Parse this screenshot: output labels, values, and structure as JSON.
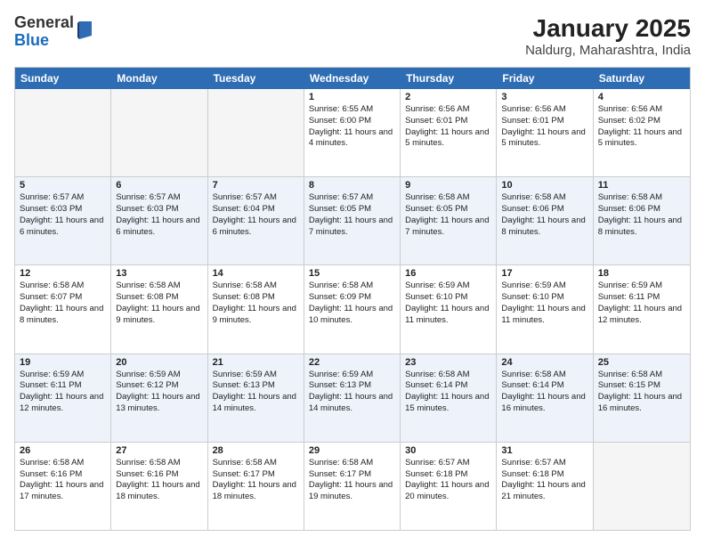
{
  "header": {
    "logo": {
      "general": "General",
      "blue": "Blue"
    },
    "month": "January 2025",
    "location": "Naldurg, Maharashtra, India"
  },
  "weekdays": [
    "Sunday",
    "Monday",
    "Tuesday",
    "Wednesday",
    "Thursday",
    "Friday",
    "Saturday"
  ],
  "rows": [
    [
      {
        "day": "",
        "info": ""
      },
      {
        "day": "",
        "info": ""
      },
      {
        "day": "",
        "info": ""
      },
      {
        "day": "1",
        "info": "Sunrise: 6:55 AM\nSunset: 6:00 PM\nDaylight: 11 hours\nand 4 minutes."
      },
      {
        "day": "2",
        "info": "Sunrise: 6:56 AM\nSunset: 6:01 PM\nDaylight: 11 hours\nand 5 minutes."
      },
      {
        "day": "3",
        "info": "Sunrise: 6:56 AM\nSunset: 6:01 PM\nDaylight: 11 hours\nand 5 minutes."
      },
      {
        "day": "4",
        "info": "Sunrise: 6:56 AM\nSunset: 6:02 PM\nDaylight: 11 hours\nand 5 minutes."
      }
    ],
    [
      {
        "day": "5",
        "info": "Sunrise: 6:57 AM\nSunset: 6:03 PM\nDaylight: 11 hours\nand 6 minutes."
      },
      {
        "day": "6",
        "info": "Sunrise: 6:57 AM\nSunset: 6:03 PM\nDaylight: 11 hours\nand 6 minutes."
      },
      {
        "day": "7",
        "info": "Sunrise: 6:57 AM\nSunset: 6:04 PM\nDaylight: 11 hours\nand 6 minutes."
      },
      {
        "day": "8",
        "info": "Sunrise: 6:57 AM\nSunset: 6:05 PM\nDaylight: 11 hours\nand 7 minutes."
      },
      {
        "day": "9",
        "info": "Sunrise: 6:58 AM\nSunset: 6:05 PM\nDaylight: 11 hours\nand 7 minutes."
      },
      {
        "day": "10",
        "info": "Sunrise: 6:58 AM\nSunset: 6:06 PM\nDaylight: 11 hours\nand 8 minutes."
      },
      {
        "day": "11",
        "info": "Sunrise: 6:58 AM\nSunset: 6:06 PM\nDaylight: 11 hours\nand 8 minutes."
      }
    ],
    [
      {
        "day": "12",
        "info": "Sunrise: 6:58 AM\nSunset: 6:07 PM\nDaylight: 11 hours\nand 8 minutes."
      },
      {
        "day": "13",
        "info": "Sunrise: 6:58 AM\nSunset: 6:08 PM\nDaylight: 11 hours\nand 9 minutes."
      },
      {
        "day": "14",
        "info": "Sunrise: 6:58 AM\nSunset: 6:08 PM\nDaylight: 11 hours\nand 9 minutes."
      },
      {
        "day": "15",
        "info": "Sunrise: 6:58 AM\nSunset: 6:09 PM\nDaylight: 11 hours\nand 10 minutes."
      },
      {
        "day": "16",
        "info": "Sunrise: 6:59 AM\nSunset: 6:10 PM\nDaylight: 11 hours\nand 11 minutes."
      },
      {
        "day": "17",
        "info": "Sunrise: 6:59 AM\nSunset: 6:10 PM\nDaylight: 11 hours\nand 11 minutes."
      },
      {
        "day": "18",
        "info": "Sunrise: 6:59 AM\nSunset: 6:11 PM\nDaylight: 11 hours\nand 12 minutes."
      }
    ],
    [
      {
        "day": "19",
        "info": "Sunrise: 6:59 AM\nSunset: 6:11 PM\nDaylight: 11 hours\nand 12 minutes."
      },
      {
        "day": "20",
        "info": "Sunrise: 6:59 AM\nSunset: 6:12 PM\nDaylight: 11 hours\nand 13 minutes."
      },
      {
        "day": "21",
        "info": "Sunrise: 6:59 AM\nSunset: 6:13 PM\nDaylight: 11 hours\nand 14 minutes."
      },
      {
        "day": "22",
        "info": "Sunrise: 6:59 AM\nSunset: 6:13 PM\nDaylight: 11 hours\nand 14 minutes."
      },
      {
        "day": "23",
        "info": "Sunrise: 6:58 AM\nSunset: 6:14 PM\nDaylight: 11 hours\nand 15 minutes."
      },
      {
        "day": "24",
        "info": "Sunrise: 6:58 AM\nSunset: 6:14 PM\nDaylight: 11 hours\nand 16 minutes."
      },
      {
        "day": "25",
        "info": "Sunrise: 6:58 AM\nSunset: 6:15 PM\nDaylight: 11 hours\nand 16 minutes."
      }
    ],
    [
      {
        "day": "26",
        "info": "Sunrise: 6:58 AM\nSunset: 6:16 PM\nDaylight: 11 hours\nand 17 minutes."
      },
      {
        "day": "27",
        "info": "Sunrise: 6:58 AM\nSunset: 6:16 PM\nDaylight: 11 hours\nand 18 minutes."
      },
      {
        "day": "28",
        "info": "Sunrise: 6:58 AM\nSunset: 6:17 PM\nDaylight: 11 hours\nand 18 minutes."
      },
      {
        "day": "29",
        "info": "Sunrise: 6:58 AM\nSunset: 6:17 PM\nDaylight: 11 hours\nand 19 minutes."
      },
      {
        "day": "30",
        "info": "Sunrise: 6:57 AM\nSunset: 6:18 PM\nDaylight: 11 hours\nand 20 minutes."
      },
      {
        "day": "31",
        "info": "Sunrise: 6:57 AM\nSunset: 6:18 PM\nDaylight: 11 hours\nand 21 minutes."
      },
      {
        "day": "",
        "info": ""
      }
    ]
  ]
}
